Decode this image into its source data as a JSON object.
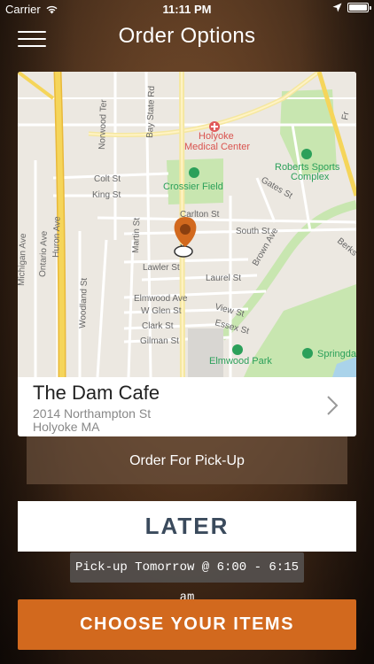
{
  "status_bar": {
    "carrier": "Carrier",
    "time": "11:11 PM"
  },
  "nav": {
    "title": "Order Options"
  },
  "map": {
    "labels": {
      "holyoke_medical_center": "Holyoke\nMedical Center",
      "crossier_field": "Crossier Field",
      "roberts_sports_complex": "Roberts Sports\nComplex",
      "elmwood_park": "Elmwood Park",
      "springdale": "Springda",
      "norwood_ter": "Norwood Ter",
      "bay_state_rd": "Bay State Rd",
      "colt_st": "Colt St",
      "king_st": "King St",
      "carlton_st": "Carlton St",
      "south_st": "South St",
      "gates_st": "Gates St",
      "lawler_st": "Lawler St",
      "laurel_st": "Laurel St",
      "elmwood_ave": "Elmwood Ave",
      "w_glen_st": "W Glen St",
      "clark_st": "Clark St",
      "gilman_st": "Gilman St",
      "view_st": "View St",
      "essex_st": "Essex St",
      "brown_ave": "Brown Ave",
      "martin_st": "Martin St",
      "michigan_ave": "Michigan Ave",
      "ontario_ave": "Ontario Ave",
      "huron_ave": "Huron Ave",
      "woodland_st": "Woodland St",
      "berks": "Berks",
      "fr": "Fr"
    }
  },
  "location": {
    "name": "The Dam Cafe",
    "address_line1": "2014 Northampton St",
    "address_line2": "Holyoke MA"
  },
  "order_type": {
    "label": "Order For Pick-Up"
  },
  "timing": {
    "later_label": "LATER",
    "pickup_time": "Pick-up Tomorrow @ 6:00 - 6:15 am"
  },
  "actions": {
    "choose_items_label": "CHOOSE YOUR ITEMS"
  },
  "colors": {
    "accent": "#d2691e",
    "later_text": "#3a4a5c",
    "pin": "#d2691e",
    "park_green": "#c8e6b0",
    "highway_yellow": "#f5d55a",
    "water": "#aad3ea"
  }
}
